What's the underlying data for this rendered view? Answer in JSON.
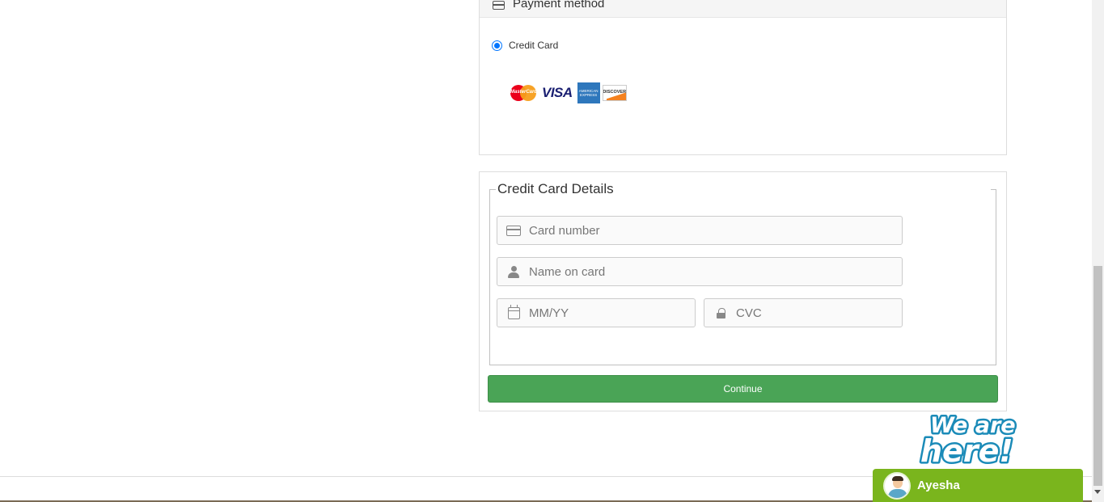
{
  "payment_method": {
    "title": "Payment method",
    "icon": "credit-card-icon",
    "option": {
      "label": "Credit Card",
      "selected": true
    },
    "card_logos": [
      "mastercard-logo",
      "visa-logo",
      "amex-logo",
      "discover-logo"
    ],
    "logo_text": {
      "mastercard": "MasterCard",
      "visa": "VISA",
      "amex": "AMERICAN EXPRESS",
      "discover": "DISCOVER"
    }
  },
  "credit_card_details": {
    "legend": "Credit Card Details",
    "fields": {
      "card_number": {
        "placeholder": "Card number",
        "icon": "credit-card-icon"
      },
      "name_on_card": {
        "placeholder": "Name on card",
        "icon": "user-icon"
      },
      "expiry": {
        "placeholder": "MM/YY",
        "icon": "calendar-icon"
      },
      "cvc": {
        "placeholder": "CVC",
        "icon": "lock-icon"
      }
    },
    "continue_label": "Continue"
  },
  "chat_widget": {
    "banner_text_1": "We are",
    "banner_text_2": "here!",
    "agent_name": "Ayesha"
  },
  "colors": {
    "continue_button": "#4aa456",
    "chat_bar": "#7ab51d",
    "radio_accent": "#0075ff"
  }
}
